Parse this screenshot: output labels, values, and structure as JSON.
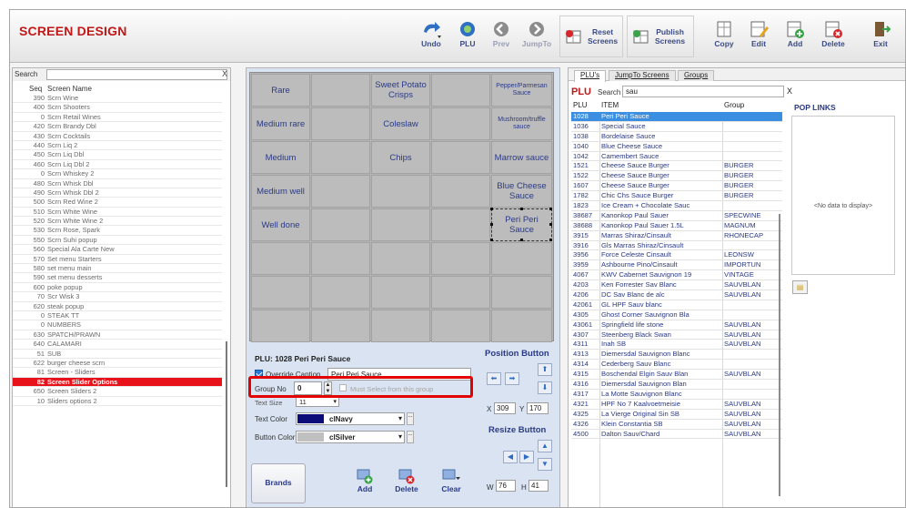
{
  "app": {
    "title": "SCREEN DESIGN"
  },
  "toolbar": {
    "undo": "Undo",
    "plu": "PLU",
    "prev": "Prev",
    "jumpto": "JumpTo",
    "reset_l1": "Reset",
    "reset_l2": "Screens",
    "publish_l1": "Publish",
    "publish_l2": "Screens",
    "copy": "Copy",
    "edit": "Edit",
    "add": "Add",
    "delete": "Delete",
    "exit": "Exit"
  },
  "screens": {
    "search_label": "Search",
    "search_value": "",
    "clear": "X",
    "col_seq": "Seq",
    "col_name": "Screen Name",
    "rows": [
      {
        "seq": "390",
        "name": "Scrn Wine"
      },
      {
        "seq": "400",
        "name": "Scrn Shooters"
      },
      {
        "seq": "0",
        "name": "Scrn Retail Wines"
      },
      {
        "seq": "420",
        "name": "Scrn Brandy Dbl"
      },
      {
        "seq": "430",
        "name": "Scrn Cocktails"
      },
      {
        "seq": "440",
        "name": "Scrn Liq 2"
      },
      {
        "seq": "450",
        "name": "Scrn Liq Dbl"
      },
      {
        "seq": "460",
        "name": "Scrn Liq Dbl 2"
      },
      {
        "seq": "0",
        "name": "Scrn Whiskey 2"
      },
      {
        "seq": "480",
        "name": "Scrn Whisk Dbl"
      },
      {
        "seq": "490",
        "name": "Scrn Whisk Dbl 2"
      },
      {
        "seq": "500",
        "name": "Scrn Red Wine 2"
      },
      {
        "seq": "510",
        "name": "Scrn White Wine"
      },
      {
        "seq": "520",
        "name": "Scrn White Wine 2"
      },
      {
        "seq": "530",
        "name": "Scrn Rose, Spark"
      },
      {
        "seq": "550",
        "name": "Scrn Suhi popup"
      },
      {
        "seq": "560",
        "name": "Special Ala Carte New"
      },
      {
        "seq": "570",
        "name": "Set menu Starters"
      },
      {
        "seq": "580",
        "name": "set menu main"
      },
      {
        "seq": "590",
        "name": "set menu desserts"
      },
      {
        "seq": "600",
        "name": "poke popup"
      },
      {
        "seq": "70",
        "name": "Scr Wisk 3"
      },
      {
        "seq": "620",
        "name": "steak popup"
      },
      {
        "seq": "0",
        "name": "STEAK TT"
      },
      {
        "seq": "0",
        "name": "NUMBERS"
      },
      {
        "seq": "630",
        "name": "SPATCH/PRAWN"
      },
      {
        "seq": "640",
        "name": "CALAMARI"
      },
      {
        "seq": "51",
        "name": "SUB"
      },
      {
        "seq": "622",
        "name": "burger cheese scrn"
      },
      {
        "seq": "81",
        "name": "Screen - Sliders"
      },
      {
        "seq": "82",
        "name": "Screen Slider Options",
        "selected": true
      },
      {
        "seq": "650",
        "name": "Screen Sliders 2"
      },
      {
        "seq": "10",
        "name": "Sliders options 2"
      }
    ]
  },
  "design": {
    "cells": [
      {
        "text": "Rare"
      },
      {
        "text": ""
      },
      {
        "text": "Sweet Potato Crisps"
      },
      {
        "text": ""
      },
      {
        "text": "Pepper/Parmesan Sauce",
        "small": true
      },
      {
        "text": "Medium rare"
      },
      {
        "text": ""
      },
      {
        "text": "Coleslaw"
      },
      {
        "text": ""
      },
      {
        "text": "Mushroom/truffle sauce",
        "small": true
      },
      {
        "text": "Medium"
      },
      {
        "text": ""
      },
      {
        "text": "Chips"
      },
      {
        "text": ""
      },
      {
        "text": "Marrow sauce"
      },
      {
        "text": "Medium well"
      },
      {
        "text": ""
      },
      {
        "text": ""
      },
      {
        "text": ""
      },
      {
        "text": "Blue Cheese Sauce"
      },
      {
        "text": "Well done"
      },
      {
        "text": ""
      },
      {
        "text": ""
      },
      {
        "text": ""
      },
      {
        "text": "Peri Peri Sauce",
        "selected": true
      },
      {
        "text": ""
      },
      {
        "text": ""
      },
      {
        "text": ""
      },
      {
        "text": ""
      },
      {
        "text": ""
      },
      {
        "text": ""
      },
      {
        "text": ""
      },
      {
        "text": ""
      },
      {
        "text": ""
      },
      {
        "text": ""
      },
      {
        "text": ""
      },
      {
        "text": ""
      },
      {
        "text": ""
      },
      {
        "text": ""
      },
      {
        "text": ""
      }
    ]
  },
  "props": {
    "plu_title": "PLU:  1028 Peri Peri Sauce",
    "override_label": "Override Caption",
    "override_value": "Peri Peri Sauce",
    "group_label": "Group No",
    "group_value": "0",
    "must_select": "Must Select from this group",
    "text_size_label": "Text Size",
    "text_size_value": "11",
    "text_color_label": "Text Color",
    "text_color_value": "clNavy",
    "text_color_hex": "#0b0b7a",
    "button_color_label": "Button Color",
    "button_color_value": "clSilver",
    "button_color_hex": "#c0c0c0"
  },
  "position": {
    "title": "Position Button",
    "x_label": "X",
    "x_value": "309",
    "y_label": "Y",
    "y_value": "170",
    "resize_title": "Resize Button",
    "w_label": "W",
    "w_value": "76",
    "h_label": "H",
    "h_value": "41"
  },
  "actions": {
    "brands": "Brands",
    "add": "Add",
    "delete": "Delete",
    "clear": "Clear"
  },
  "plu_panel": {
    "tabs": [
      "PLU's",
      "JumpTo Screens",
      "Groups"
    ],
    "heading": "PLU",
    "search_label": "Search",
    "search_value": "sau",
    "clear": "X",
    "col_plu": "PLU",
    "col_item": "ITEM",
    "col_group": "Group",
    "rows": [
      {
        "plu": "1028",
        "item": "Peri Peri Sauce",
        "group": "",
        "selected": true
      },
      {
        "plu": "1036",
        "item": "Special Sauce",
        "group": ""
      },
      {
        "plu": "1038",
        "item": "Bordelaise Sauce",
        "group": ""
      },
      {
        "plu": "1040",
        "item": "Blue Cheese Sauce",
        "group": ""
      },
      {
        "plu": "1042",
        "item": "Camembert Sauce",
        "group": ""
      },
      {
        "plu": "1521",
        "item": "Cheese Sauce Burger",
        "group": "BURGER"
      },
      {
        "plu": "1522",
        "item": "Cheese Sauce Burger",
        "group": "BURGER"
      },
      {
        "plu": "1607",
        "item": "Cheese Sauce Burger",
        "group": "BURGER"
      },
      {
        "plu": "1782",
        "item": "Chic Chs Sauce Burger",
        "group": "BURGER"
      },
      {
        "plu": "1823",
        "item": "Ice Cream + Chocolate Sauc",
        "group": ""
      },
      {
        "plu": "38687",
        "item": "Kanonkop Paul Sauer",
        "group": "SPECWINE"
      },
      {
        "plu": "38688",
        "item": "Kanonkop Paul Sauer 1.5L",
        "group": "MAGNUM"
      },
      {
        "plu": "3915",
        "item": "Marras Shiraz/Cinsault",
        "group": "RHONECAP"
      },
      {
        "plu": "3916",
        "item": "Gls Marras Shiraz/Cinsault",
        "group": ""
      },
      {
        "plu": "3956",
        "item": "Force Celeste Cinsault",
        "group": "LEONSW"
      },
      {
        "plu": "3959",
        "item": "Ashbourne Pino/Cinsault",
        "group": "IMPORTUN"
      },
      {
        "plu": "4067",
        "item": "KWV Cabernet Sauvignon 19",
        "group": "VINTAGE"
      },
      {
        "plu": "4203",
        "item": "Ken Forrester Sav Blanc",
        "group": "SAUVBLAN"
      },
      {
        "plu": "4206",
        "item": "DC Sav Blanc de alc",
        "group": "SAUVBLAN"
      },
      {
        "plu": "42061",
        "item": "GL HPF Sauv blanc",
        "group": ""
      },
      {
        "plu": "4305",
        "item": "Ghost Corner Sauvignon Bla",
        "group": ""
      },
      {
        "plu": "43061",
        "item": "Springfield life stone",
        "group": "SAUVBLAN"
      },
      {
        "plu": "4307",
        "item": "Steenberg Black Swan",
        "group": "SAUVBLAN"
      },
      {
        "plu": "4311",
        "item": "Inah SB",
        "group": "SAUVBLAN"
      },
      {
        "plu": "4313",
        "item": "Diemersdal Sauvignon Blanc",
        "group": ""
      },
      {
        "plu": "4314",
        "item": "Cederberg Sauv Blanc",
        "group": ""
      },
      {
        "plu": "4315",
        "item": "Boschendal Elgin Sauv Blan",
        "group": "SAUVBLAN"
      },
      {
        "plu": "4316",
        "item": "Diemersdal Sauvignon Blan",
        "group": ""
      },
      {
        "plu": "4317",
        "item": "La Motte Sauvignon Blanc",
        "group": ""
      },
      {
        "plu": "4321",
        "item": "HPF No 7 Kaalvoetmeisie",
        "group": "SAUVBLAN"
      },
      {
        "plu": "4325",
        "item": "La Vierge Original Sin SB",
        "group": "SAUVBLAN"
      },
      {
        "plu": "4326",
        "item": "Klein Constantia SB",
        "group": "SAUVBLAN"
      },
      {
        "plu": "4500",
        "item": "Dalton Sauv/Chard",
        "group": "SAUVBLAN"
      }
    ]
  },
  "pop_links": {
    "title": "POP LINKS",
    "empty": "<No data to display>"
  }
}
